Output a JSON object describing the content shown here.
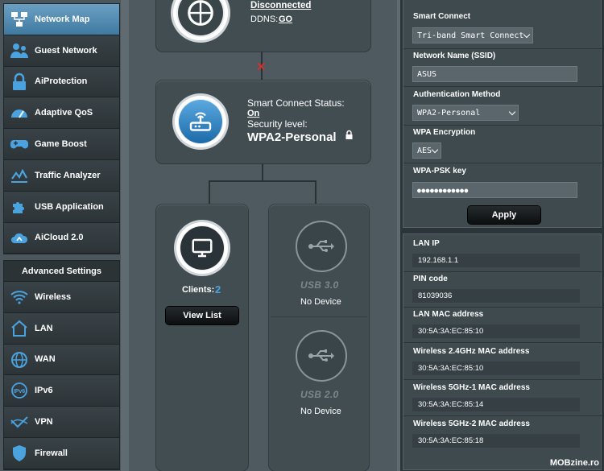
{
  "sidebar": {
    "items": [
      {
        "label": "Network Map",
        "icon": "network-map-icon"
      },
      {
        "label": "Guest Network",
        "icon": "guest-network-icon"
      },
      {
        "label": "AiProtection",
        "icon": "lock-icon"
      },
      {
        "label": "Adaptive QoS",
        "icon": "speedometer-icon"
      },
      {
        "label": "Game Boost",
        "icon": "gamepad-icon"
      },
      {
        "label": "Traffic Analyzer",
        "icon": "chart-icon"
      },
      {
        "label": "USB Application",
        "icon": "puzzle-icon"
      },
      {
        "label": "AiCloud 2.0",
        "icon": "cloud-icon"
      }
    ],
    "advanced_header": "Advanced Settings",
    "advanced_items": [
      {
        "label": "Wireless",
        "icon": "wifi-icon"
      },
      {
        "label": "LAN",
        "icon": "home-icon"
      },
      {
        "label": "WAN",
        "icon": "globe-icon"
      },
      {
        "label": "IPv6",
        "icon": "ipv6-icon"
      },
      {
        "label": "VPN",
        "icon": "vpn-icon"
      },
      {
        "label": "Firewall",
        "icon": "shield-icon"
      }
    ]
  },
  "map": {
    "internet_status": "Disconnected",
    "ddns_label": "DDNS:",
    "ddns_link": "GO",
    "router": {
      "smart_connect_label": "Smart Connect Status:",
      "smart_connect_value": "On",
      "security_label": "Security level:",
      "security_value": "WPA2-Personal"
    },
    "clients_label": "Clients:",
    "clients_count": "2",
    "view_list": "View List",
    "usb1": {
      "title": "USB 3.0",
      "status": "No Device"
    },
    "usb2": {
      "title": "USB 2.0",
      "status": "No Device"
    }
  },
  "panel": {
    "smart_connect_label": "Smart Connect",
    "smart_connect_value": "Tri-band Smart Connect",
    "ssid_label": "Network Name (SSID)",
    "ssid_value": "ASUS",
    "auth_label": "Authentication Method",
    "auth_value": "WPA2-Personal",
    "enc_label": "WPA Encryption",
    "enc_value": "AES",
    "psk_label": "WPA-PSK key",
    "psk_value": "●●●●●●●●●●●●",
    "apply": "Apply",
    "info": [
      {
        "label": "LAN IP",
        "value": "192.168.1.1"
      },
      {
        "label": "PIN code",
        "value": "81039036"
      },
      {
        "label": "LAN MAC address",
        "value": "30:5A:3A:EC:85:10"
      },
      {
        "label": "Wireless 2.4GHz MAC address",
        "value": "30:5A:3A:EC:85:10"
      },
      {
        "label": "Wireless 5GHz-1 MAC address",
        "value": "30:5A:3A:EC:85:14"
      },
      {
        "label": "Wireless 5GHz-2 MAC address",
        "value": "30:5A:3A:EC:85:18"
      }
    ]
  },
  "watermark": "MOBzine.ro",
  "colors": {
    "accent": "#4aa3df",
    "disconnect": "#d0312d"
  }
}
